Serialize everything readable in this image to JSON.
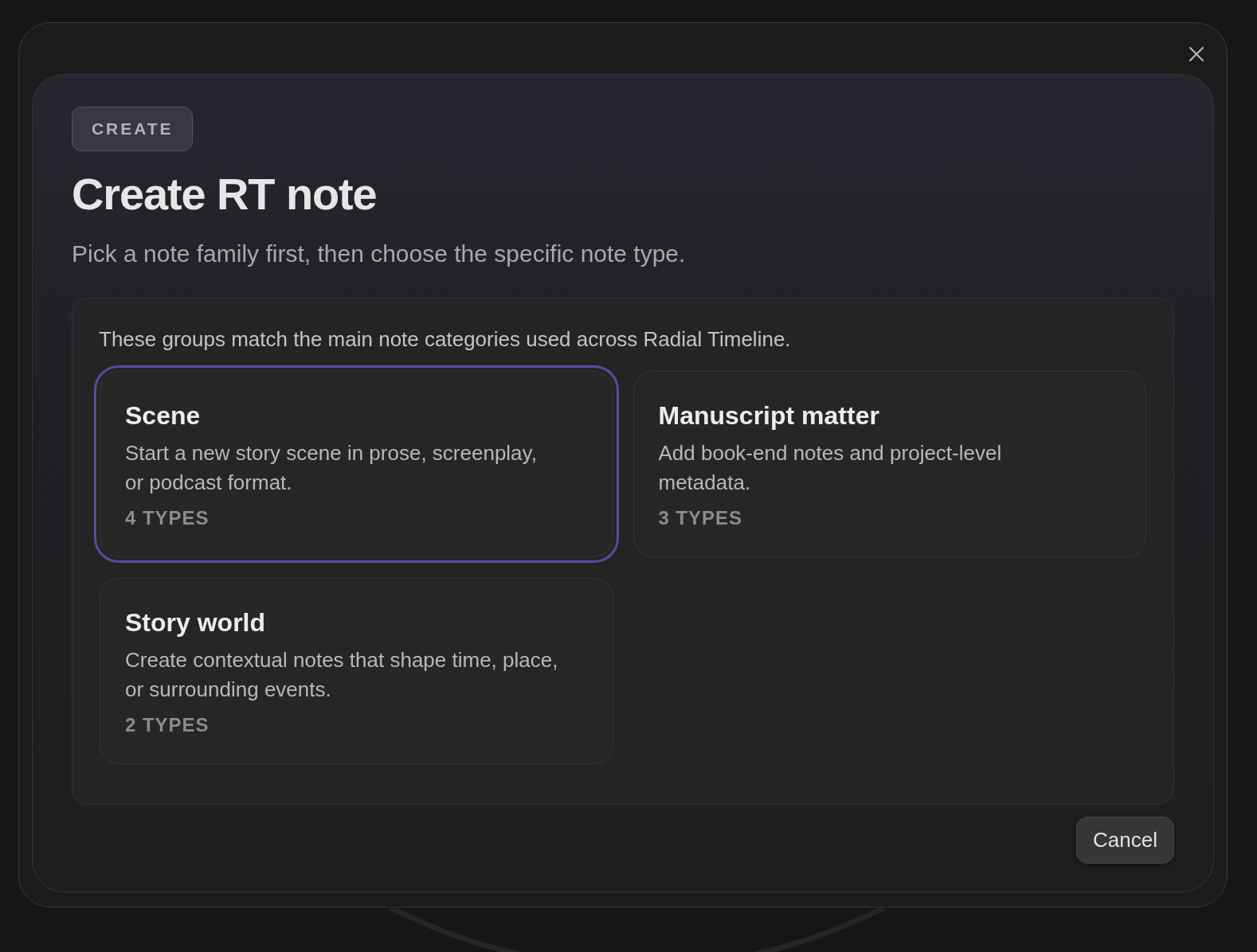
{
  "dialog": {
    "badge": "CREATE",
    "title": "Create RT note",
    "subtitle": "Pick a note family first, then choose the specific note type."
  },
  "families_panel": {
    "intro": "These groups match the main note categories used across Radial Timeline.",
    "families": [
      {
        "name": "Scene",
        "description": "Start a new story scene in prose, screenplay, or podcast format.",
        "count": "4 TYPES",
        "selected": true
      },
      {
        "name": "Manuscript matter",
        "description": "Add book-end notes and project-level metadata.",
        "count": "3 TYPES",
        "selected": false
      },
      {
        "name": "Story world",
        "description": "Create contextual notes that shape time, place, or surrounding events.",
        "count": "2 TYPES",
        "selected": false
      }
    ]
  },
  "buttons": [
    {
      "label": "Cancel"
    }
  ]
}
